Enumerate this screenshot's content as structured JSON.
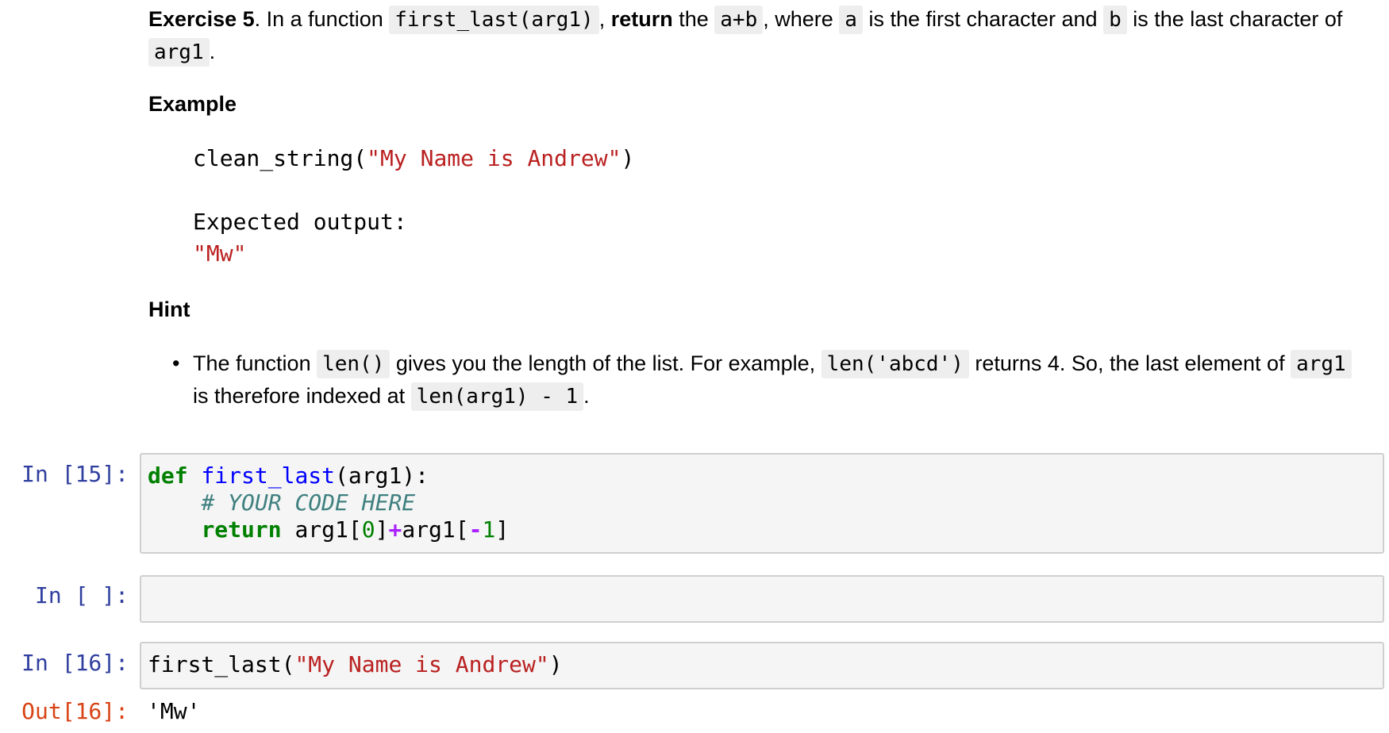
{
  "exercise": {
    "title": "Exercise 5",
    "t1": ". In a function ",
    "c1": "first_last(arg1)",
    "t2": ", ",
    "kw_return": "return",
    "t3": " the ",
    "c2": "a+b",
    "t4": ", where ",
    "c3": "a",
    "t5": " is the first character and ",
    "c4": "b",
    "t6": " is the last character of ",
    "c5": "arg1",
    "t7": "."
  },
  "example": {
    "heading": "Example",
    "call_fn": "clean_string(",
    "call_arg": "\"My Name is Andrew\"",
    "call_end": ")",
    "expected_label": "Expected output:",
    "expected_value": "\"Mw\""
  },
  "hint": {
    "heading": "Hint",
    "bullet": "•",
    "t1": "The function ",
    "c1": "len()",
    "t2": " gives you the length of the list. For example, ",
    "c2": "len('abcd')",
    "t3": " returns 4. So, the last element of ",
    "c3": "arg1",
    "t4": " is therefore indexed at ",
    "c4": "len(arg1) - 1",
    "t5": "."
  },
  "cells": {
    "c1": {
      "prompt": "In [15]:",
      "kw_def": "def",
      "fn_name": "first_last",
      "sig": "(arg1):",
      "comment": "# YOUR CODE HERE",
      "kw_return": "return",
      "r1": " arg1[",
      "n0": "0",
      "r2": "]",
      "plus": "+",
      "r3": "arg1[",
      "minus": "-",
      "n1": "1",
      "r4": "]"
    },
    "c2": {
      "prompt": "In [ ]:"
    },
    "c3": {
      "prompt": "In [16]:",
      "call": "first_last(",
      "arg": "\"My Name is Andrew\"",
      "end": ")"
    },
    "out": {
      "prompt": "Out[16]:",
      "value": "'Mw'"
    }
  },
  "colors": {
    "in_prompt": "#303f9f",
    "out_prompt": "#d84315",
    "string": "#ba2121",
    "keyword": "#008000",
    "function": "#0000ff",
    "comment": "#408080",
    "operator": "#aa22ff",
    "cell_bg": "#f5f5f5",
    "cell_border": "#cfcfcf"
  }
}
